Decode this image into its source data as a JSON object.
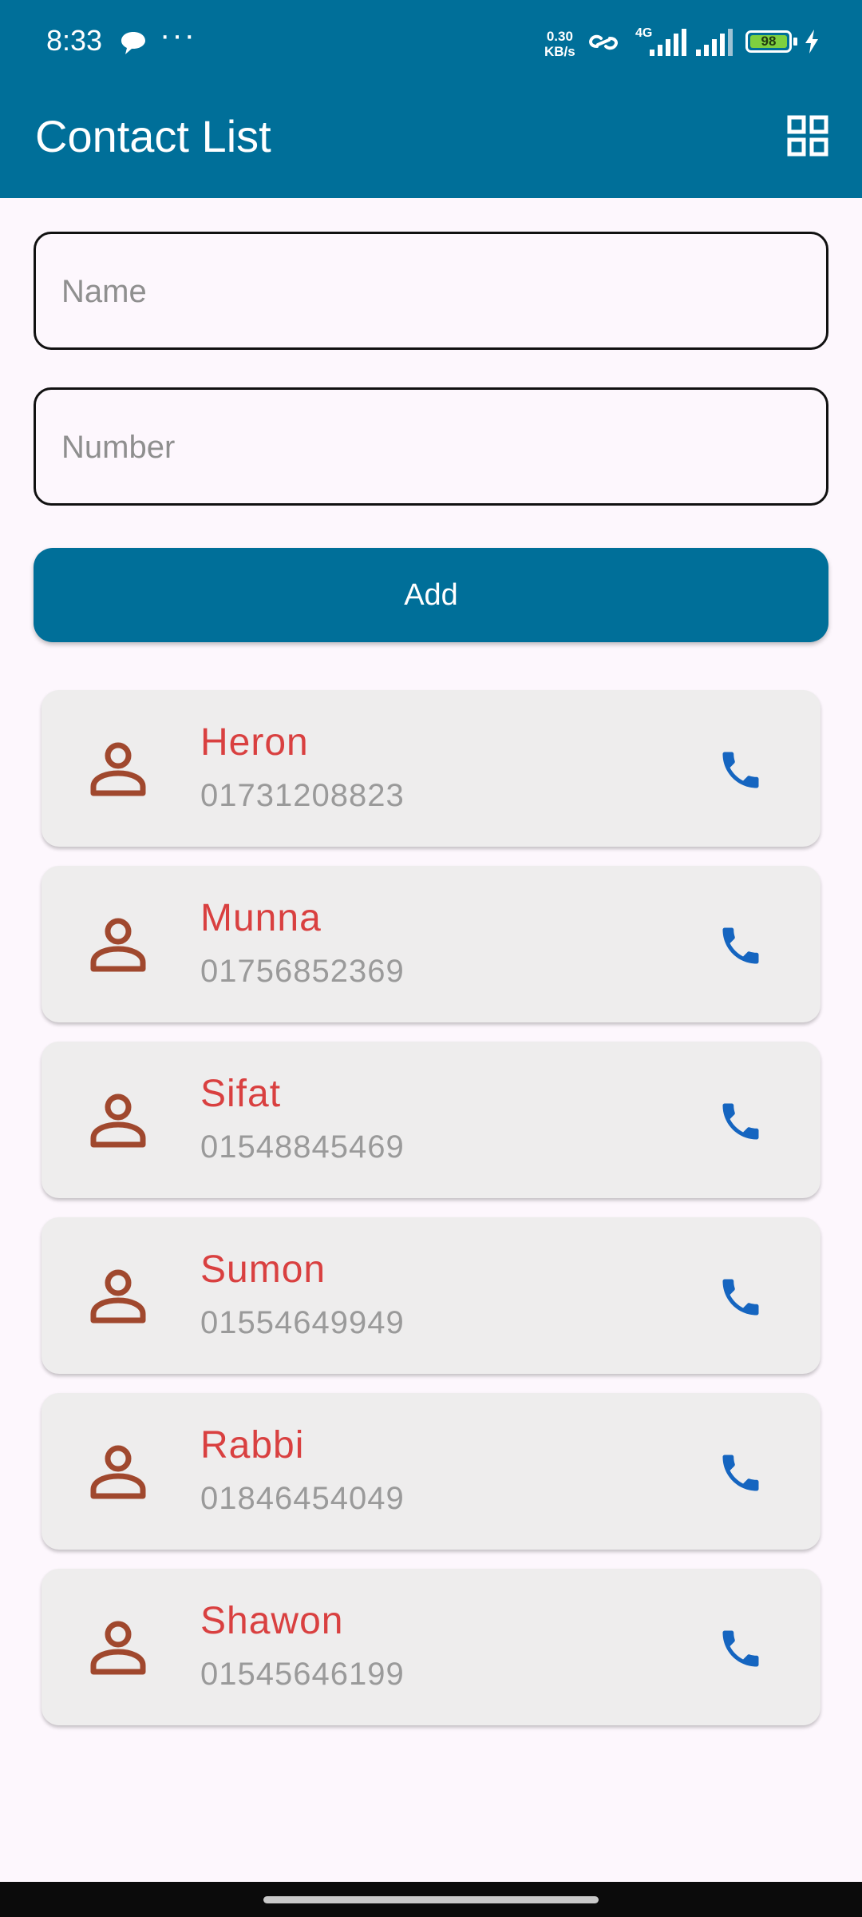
{
  "status_bar": {
    "time": "8:33",
    "dots": "···",
    "speed_value": "0.30",
    "speed_unit": "KB/s",
    "network": "4G",
    "battery": "98"
  },
  "app_bar": {
    "title": "Contact List",
    "grid_icon": "grid-view-icon"
  },
  "form": {
    "name_placeholder": "Name",
    "name_value": "",
    "number_placeholder": "Number",
    "number_value": "",
    "add_label": "Add"
  },
  "contacts": [
    {
      "name": "Heron",
      "number": "01731208823"
    },
    {
      "name": "Munna",
      "number": "01756852369"
    },
    {
      "name": "Sifat",
      "number": "01548845469"
    },
    {
      "name": "Sumon",
      "number": "01554649949"
    },
    {
      "name": "Rabbi",
      "number": "01846454049"
    },
    {
      "name": "Shawon",
      "number": "01545646199"
    }
  ],
  "icons": {
    "contact": "person-outline-icon",
    "call": "phone-icon"
  },
  "colors": {
    "primary": "#006f99",
    "background": "#fdf7fd",
    "card": "#eeeded",
    "contact_name": "#d94040",
    "contact_number": "#9a9a9a",
    "person_icon": "#a0482e",
    "call_icon": "#1565c0"
  }
}
